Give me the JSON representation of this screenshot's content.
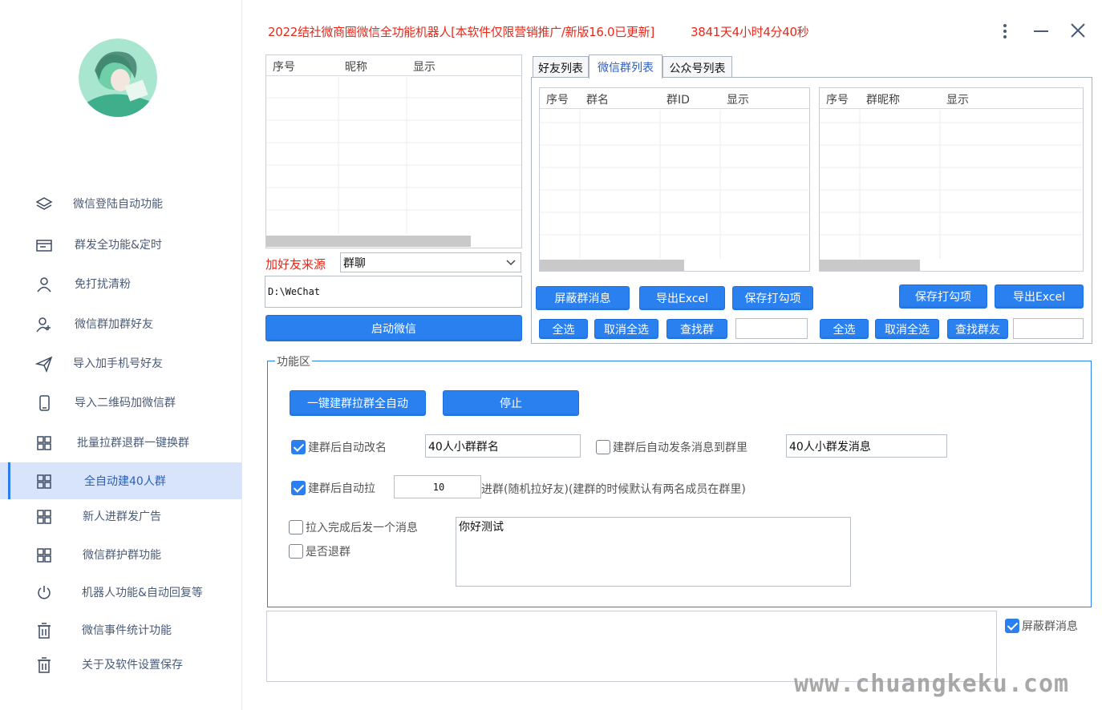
{
  "window": {
    "title": "2022结社微商圈微信全功能机器人[本软件仅限营销推广/新版16.0已更新]",
    "uptime": "3841天4小时4分40秒"
  },
  "sidebar": {
    "items": [
      {
        "label": "微信登陆自动功能",
        "icon": "layers-icon"
      },
      {
        "label": "群发全功能&定时",
        "icon": "folder-icon"
      },
      {
        "label": "免打扰清粉",
        "icon": "user-icon"
      },
      {
        "label": "微信群加群好友",
        "icon": "user-add-icon"
      },
      {
        "label": "导入加手机号好友",
        "icon": "send-icon"
      },
      {
        "label": "导入二维码加微信群",
        "icon": "phone-icon"
      },
      {
        "label": "批量拉群退群一键换群",
        "icon": "grid-icon"
      },
      {
        "label": "全自动建40人群",
        "icon": "grid-icon",
        "active": true
      },
      {
        "label": "新人进群发广告",
        "icon": "grid-icon"
      },
      {
        "label": "微信群护群功能",
        "icon": "grid-icon"
      },
      {
        "label": "机器人功能&自动回复等",
        "icon": "power-icon"
      },
      {
        "label": "微信事件统计功能",
        "icon": "trash-icon"
      },
      {
        "label": "关于及软件设置保存",
        "icon": "trash-icon"
      }
    ]
  },
  "friends_grid": {
    "columns": [
      "序号",
      "昵称",
      "显示"
    ]
  },
  "source": {
    "label": "加好友来源",
    "selected": "群聊",
    "path": "D:\\WeChat",
    "start_button": "启动微信"
  },
  "tabs": [
    "好友列表",
    "微信群列表",
    "公众号列表"
  ],
  "group_grid": {
    "columns": [
      "序号",
      "群名",
      "群ID",
      "显示"
    ],
    "buttons": {
      "mute": "屏蔽群消息",
      "export": "导出Excel",
      "save_checked": "保存打勾项",
      "select_all": "全选",
      "deselect_all": "取消全选",
      "find": "查找群"
    }
  },
  "member_grid": {
    "columns": [
      "序号",
      "群昵称",
      "显示"
    ],
    "buttons": {
      "save_checked": "保存打勾项",
      "export": "导出Excel",
      "select_all": "全选",
      "deselect_all": "取消全选",
      "find": "查找群友"
    }
  },
  "function_area": {
    "title": "功能区",
    "auto_button": "一键建群拉群全自动",
    "stop_button": "停止",
    "rename_label": "建群后自动改名",
    "rename_checked": true,
    "rename_value": "40人小群群名",
    "send_msg_label": "建群后自动发条消息到群里",
    "send_msg_checked": false,
    "send_msg_value": "40人小群发消息",
    "auto_pull_label": "建群后自动拉",
    "auto_pull_checked": true,
    "auto_pull_value": "10",
    "auto_pull_suffix": "进群(随机拉好友)(建群的时候默认有两名成员在群里)",
    "after_pull_label": "拉入完成后发一个消息",
    "after_pull_checked": false,
    "quit_label": "是否退群",
    "quit_checked": false,
    "message_text": "你好测试"
  },
  "log": {
    "mute_label": "屏蔽群消息",
    "mute_checked": true
  },
  "watermark": "www.chuangkeku.com",
  "colors": {
    "accent": "#2b80f0",
    "title_red": "#e8281a",
    "active_nav_bg": "#d8e4fb"
  }
}
